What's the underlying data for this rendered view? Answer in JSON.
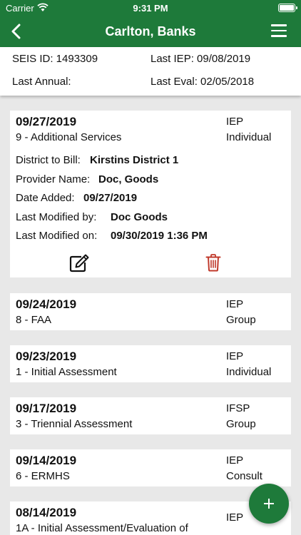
{
  "status_bar": {
    "carrier": "Carrier",
    "time": "9:31 PM"
  },
  "header": {
    "title": "Carlton, Banks"
  },
  "student": {
    "seis_id": "SEIS ID: 1493309",
    "last_iep": "Last IEP:  09/08/2019",
    "last_annual": "Last Annual:",
    "last_eval": "Last Eval:  02/05/2018"
  },
  "services": [
    {
      "date": "09/27/2019",
      "service": "9 - Additional Services",
      "type": "IEP",
      "group": "Individual",
      "district_label": "District to Bill:",
      "district": "Kirstins District 1",
      "provider_label": "Provider Name:",
      "provider": "Doc, Goods",
      "added_label": "Date Added:",
      "added": "09/27/2019",
      "modified_by_label": "Last Modified by:",
      "modified_by": "Doc Goods",
      "modified_on_label": "Last Modified on:",
      "modified_on": "09/30/2019 1:36 PM"
    },
    {
      "date": "09/24/2019",
      "service": "8 - FAA",
      "type": "IEP",
      "group": "Group"
    },
    {
      "date": "09/23/2019",
      "service": "1 - Initial Assessment",
      "type": "IEP",
      "group": "Individual"
    },
    {
      "date": "09/17/2019",
      "service": "3 - Triennial Assessment",
      "type": "IFSP",
      "group": "Group"
    },
    {
      "date": "09/14/2019",
      "service": "6 - ERMHS",
      "type": "IEP",
      "group": "Consult"
    },
    {
      "date": "08/14/2019",
      "service": "1A - Initial Assessment/Evaluation of",
      "type": "IEP",
      "group": ""
    }
  ],
  "icons": {
    "back": "chevron-left-icon",
    "menu": "hamburger-menu-icon",
    "edit": "edit-icon",
    "delete": "trash-icon",
    "add": "plus-icon"
  },
  "colors": {
    "primary": "#1e7a3a",
    "delete": "#c0392b",
    "background": "#e8e8e8"
  }
}
